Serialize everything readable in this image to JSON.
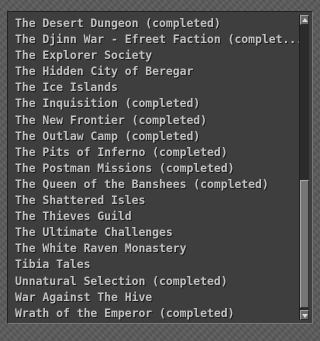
{
  "quest_list": {
    "items": [
      "The Desert Dungeon (completed)",
      "The Djinn War - Efreet Faction (complet...",
      "The Explorer Society",
      "The Hidden City of Beregar",
      "The Ice Islands",
      "The Inquisition (completed)",
      "The New Frontier (completed)",
      "The Outlaw Camp (completed)",
      "The Pits of Inferno (completed)",
      "The Postman Missions (completed)",
      "The Queen of the Banshees (completed)",
      "The Shattered Isles",
      "The Thieves Guild",
      "The Ultimate Challenges",
      "The White Raven Monastery",
      "Tibia Tales",
      "Unnatural Selection (completed)",
      "War Against The Hive",
      "Wrath of the Emperor (completed)"
    ]
  },
  "scrollbar": {
    "up_icon": "arrow-up-icon",
    "down_icon": "arrow-down-icon",
    "position_fraction": 0.58
  },
  "colors": {
    "panel_background": "#3e3e3e",
    "frame_background": "#595959",
    "item_text": "#c0c0c0"
  }
}
